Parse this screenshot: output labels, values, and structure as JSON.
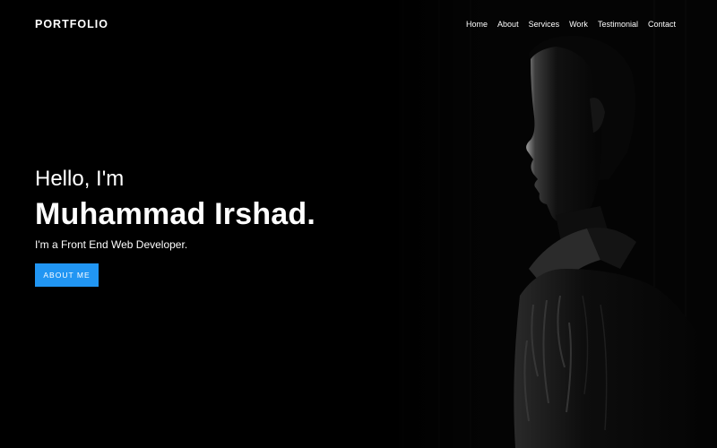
{
  "header": {
    "brand": "PORTFOLIO",
    "nav": [
      {
        "label": "Home"
      },
      {
        "label": "About"
      },
      {
        "label": "Services"
      },
      {
        "label": "Work"
      },
      {
        "label": "Testimonial"
      },
      {
        "label": "Contact"
      }
    ]
  },
  "hero": {
    "greeting": "Hello, I'm",
    "name": "Muhammad Irshad.",
    "role": "I'm a Front End Web Developer.",
    "cta_label": "ABOUT ME"
  },
  "colors": {
    "background": "#000000",
    "accent": "#2196f3",
    "text": "#ffffff"
  }
}
